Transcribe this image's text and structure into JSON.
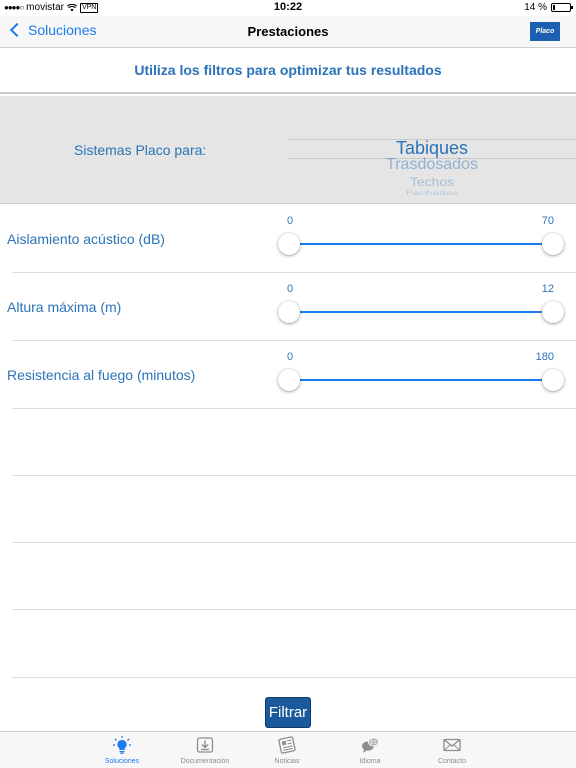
{
  "status_bar": {
    "carrier": "movistar",
    "vpn": "VPN",
    "time": "10:22",
    "battery": "14 %",
    "battery_level": 0.14
  },
  "nav": {
    "back_label": "Soluciones",
    "title": "Prestaciones",
    "logo_text": "Placo"
  },
  "headline": "Utiliza los filtros para optimizar tus resultados",
  "picker": {
    "label": "Sistemas Placo para:",
    "options": [
      "Tabiques",
      "Trasdosados",
      "Techos",
      "Fachadas"
    ],
    "selected": "Tabiques"
  },
  "filters": [
    {
      "label": "Aislamiento acústico (dB)",
      "min": "0",
      "max": "70",
      "low": 0,
      "high": 70
    },
    {
      "label": "Altura máxima (m)",
      "min": "0",
      "max": "12",
      "low": 0,
      "high": 12
    },
    {
      "label": "Resistencia al fuego (minutos)",
      "min": "0",
      "max": "180",
      "low": 0,
      "high": 180
    }
  ],
  "filter_button": "Filtrar",
  "tabs": [
    {
      "label": "Soluciones",
      "icon": "lightbulb-icon",
      "active": true
    },
    {
      "label": "Documentación",
      "icon": "download-tray-icon",
      "active": false
    },
    {
      "label": "Noticias",
      "icon": "newspaper-icon",
      "active": false
    },
    {
      "label": "Idioma",
      "icon": "chat-bubbles-icon",
      "active": false
    },
    {
      "label": "Contacto",
      "icon": "envelope-icon",
      "active": false
    }
  ],
  "colors": {
    "accent": "#1b7cf0",
    "text_blue": "#2a73b7",
    "button": "#1a5a9a"
  }
}
